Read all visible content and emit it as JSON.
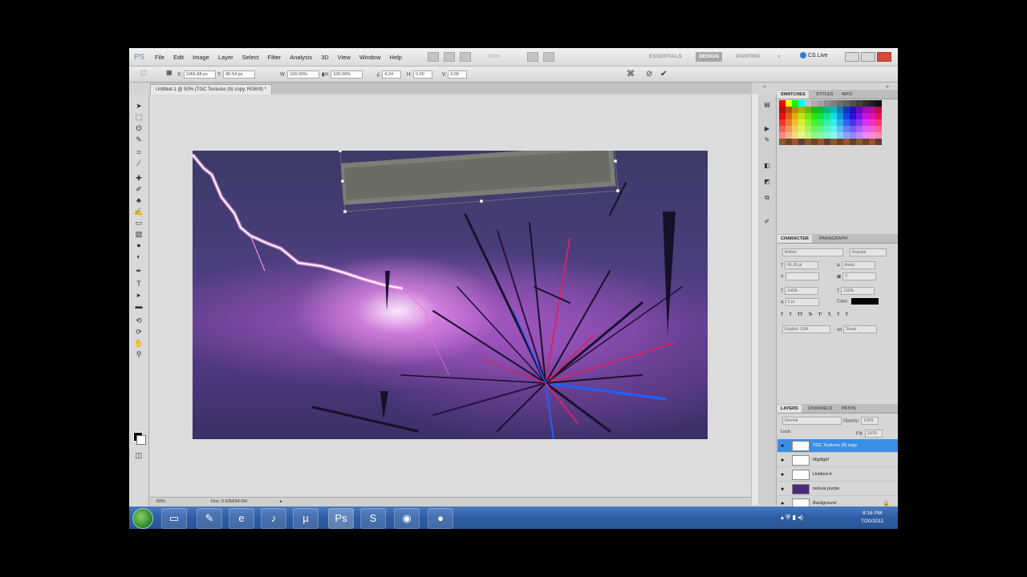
{
  "app": {
    "logo": "PS"
  },
  "menu": [
    "File",
    "Edit",
    "Image",
    "Layer",
    "Select",
    "Filter",
    "Analysis",
    "3D",
    "View",
    "Window",
    "Help"
  ],
  "zoom_display": "100%",
  "workspaces": [
    "ESSENTIALS",
    "DESIGN",
    "PAINTING"
  ],
  "workspace_more": "»",
  "cs_live": "CS Live",
  "options": {
    "x_label": "X:",
    "x_value": "1066.88 px",
    "y_label": "Y:",
    "y_value": "80.54 px",
    "w_label": "W:",
    "w_value": "100.00%",
    "h_label": "H:",
    "h_value": "100.00%",
    "angle_value": "4.24",
    "hskew_label": "H:",
    "hskew_value": "0.00",
    "vskew_label": "V:",
    "vskew_value": "0.00",
    "cancel_icon": "⊘",
    "commit_icon": "✔"
  },
  "document_tab": "Untitled-1 @ 50% (TGC Textures (9) copy, RGB/8) *",
  "status": {
    "zoom": "50%",
    "doc": "Doc: 5.93M/94.0M"
  },
  "panels": {
    "swatch_tabs": [
      "SWATCHES",
      "STYLES",
      "INFO"
    ],
    "char_tabs": [
      "CHARACTER",
      "PARAGRAPH"
    ],
    "font_family": "Bellion",
    "font_style": "Regular",
    "font_size": "60.26 pt",
    "leading": "(Auto)",
    "tracking": "0",
    "vscale": "100%",
    "hscale": "100%",
    "baseline": "0 pt",
    "color_label": "Color:",
    "language": "English: USA",
    "aa": "Sharp",
    "text_style_buttons": [
      "T",
      "T",
      "TT",
      "Tr",
      "T¹",
      "T,",
      "T",
      "T"
    ],
    "layer_tabs": [
      "LAYERS",
      "CHANNELS",
      "PATHS"
    ],
    "blend_mode": "Normal",
    "opacity_label": "Opacity:",
    "opacity": "100%",
    "lock_label": "Lock:",
    "fill_label": "Fill:",
    "fill": "100%"
  },
  "layers": [
    {
      "name": "TGC Textures (9) copy",
      "selected": true
    },
    {
      "name": "hfgdfgdf",
      "selected": false
    },
    {
      "name": "Untitled-4",
      "selected": false
    },
    {
      "name": "nebula purple",
      "selected": false
    },
    {
      "name": "Background",
      "selected": false
    }
  ],
  "taskbar": {
    "time": "8:16 PM",
    "date": "7/20/2011"
  },
  "colors": {
    "accent": "#3a8ee6",
    "taskbar": "#3060a8",
    "canvas_bg": "#dcdcdc"
  }
}
